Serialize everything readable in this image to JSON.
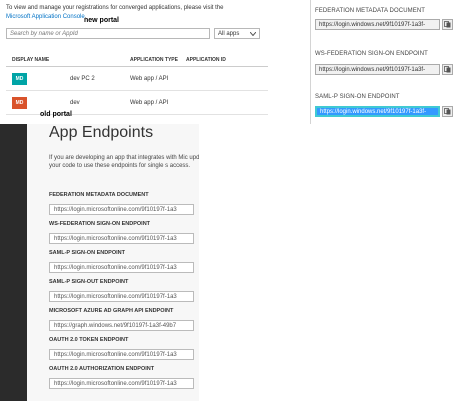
{
  "new_portal": {
    "intro_text": "To view and manage your registrations for converged applications, please visit the ",
    "intro_link": "Microsoft Application Console",
    "intro_end": ".",
    "label": "new portal",
    "search_placeholder": "Search by name or AppId",
    "filter_value": "All apps",
    "table": {
      "headers": [
        "DISPLAY NAME",
        "APPLICATION TYPE",
        "APPLICATION ID"
      ],
      "rows": [
        {
          "initials": "MD",
          "color": "#00a4a6",
          "name": "dev PC 2",
          "type": "Web app / API",
          "id": ""
        },
        {
          "initials": "MD",
          "color": "#d9532b",
          "name": "dev",
          "type": "Web app / API",
          "id": ""
        }
      ]
    }
  },
  "new_endpoints": [
    {
      "label": "FEDERATION METADATA DOCUMENT",
      "value": "https://login.windows.net/9f10197f-1a3f-",
      "selected": false
    },
    {
      "label": "WS-FEDERATION SIGN-ON ENDPOINT",
      "value": "https://login.windows.net/9f10197f-1a3f-",
      "selected": false
    },
    {
      "label": "SAML-P SIGN-ON ENDPOINT",
      "value": "https://login.windows.net/9f10197f-1a3f-",
      "selected": true
    }
  ],
  "old_portal": {
    "label": "old portal",
    "title": "App Endpoints",
    "description": "If you are developing an app that integrates with Mic update your code to use these endpoints for single s access.",
    "endpoints": [
      {
        "label": "FEDERATION METADATA DOCUMENT",
        "value": "https://login.microsoftonline.com/9f10197f-1a3"
      },
      {
        "label": "WS-FEDERATION SIGN-ON ENDPOINT",
        "value": "https://login.microsoftonline.com/9f10197f-1a3"
      },
      {
        "label": "SAML-P SIGN-ON ENDPOINT",
        "value": "https://login.microsoftonline.com/9f10197f-1a3"
      },
      {
        "label": "SAML-P SIGN-OUT ENDPOINT",
        "value": "https://login.microsoftonline.com/9f10197f-1a3"
      },
      {
        "label": "MICROSOFT AZURE AD GRAPH API ENDPOINT",
        "value": "https://graph.windows.net/9f10197f-1a3f-49b7"
      },
      {
        "label": "OAUTH 2.0 TOKEN ENDPOINT",
        "value": "https://login.microsoftonline.com/9f10197f-1a3"
      },
      {
        "label": "OAUTH 2.0 AUTHORIZATION ENDPOINT",
        "value": "https://login.microsoftonline.com/9f10197f-1a3"
      }
    ]
  },
  "icons": {
    "copy": "copy-icon",
    "dropdown": "chevron-down-icon"
  }
}
